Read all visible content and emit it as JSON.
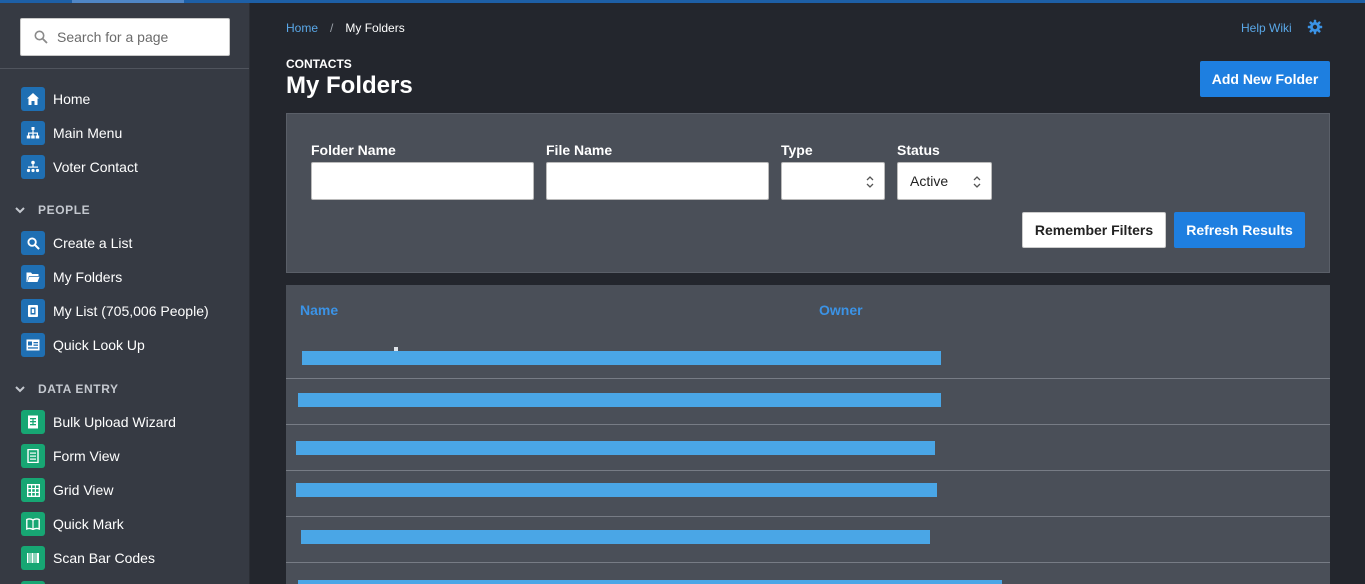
{
  "sidebar": {
    "search_placeholder": "Search for a page",
    "items_top": [
      {
        "label": "Home",
        "icon": "home-icon"
      },
      {
        "label": "Main Menu",
        "icon": "sitemap-icon"
      },
      {
        "label": "Voter Contact",
        "icon": "people-tree-icon"
      }
    ],
    "people_label": "PEOPLE",
    "people_items": [
      {
        "label": "Create a List",
        "icon": "search-icon"
      },
      {
        "label": "My Folders",
        "icon": "folder-icon"
      },
      {
        "label": "My List (705,006 People)",
        "icon": "list-book-icon"
      },
      {
        "label": "Quick Look Up",
        "icon": "id-card-icon"
      }
    ],
    "data_entry_label": "DATA ENTRY",
    "data_entry_items": [
      {
        "label": "Bulk Upload Wizard",
        "icon": "spreadsheet-icon"
      },
      {
        "label": "Form View",
        "icon": "form-icon"
      },
      {
        "label": "Grid View",
        "icon": "grid-icon"
      },
      {
        "label": "Quick Mark",
        "icon": "book-icon"
      },
      {
        "label": "Scan Bar Codes",
        "icon": "barcode-icon"
      }
    ]
  },
  "breadcrumb": {
    "home": "Home",
    "separator": "/",
    "current": "My Folders"
  },
  "header": {
    "help": "Help Wiki",
    "kicker": "CONTACTS",
    "title": "My Folders",
    "add_button": "Add New Folder"
  },
  "filters": {
    "folder_name_label": "Folder Name",
    "file_name_label": "File Name",
    "type_label": "Type",
    "type_value": "",
    "status_label": "Status",
    "status_value": "Active",
    "remember_button": "Remember Filters",
    "refresh_button": "Refresh Results"
  },
  "table": {
    "columns": [
      "Name",
      "Owner"
    ],
    "rows_note_hidden": true
  },
  "colors": {
    "accent": "#1e7fe0",
    "link": "#3b93e6",
    "sidebar_bg": "#363a43",
    "page_bg": "#23262d",
    "panel_bg": "#4a4f58",
    "redaction": "#4aa6e6"
  }
}
